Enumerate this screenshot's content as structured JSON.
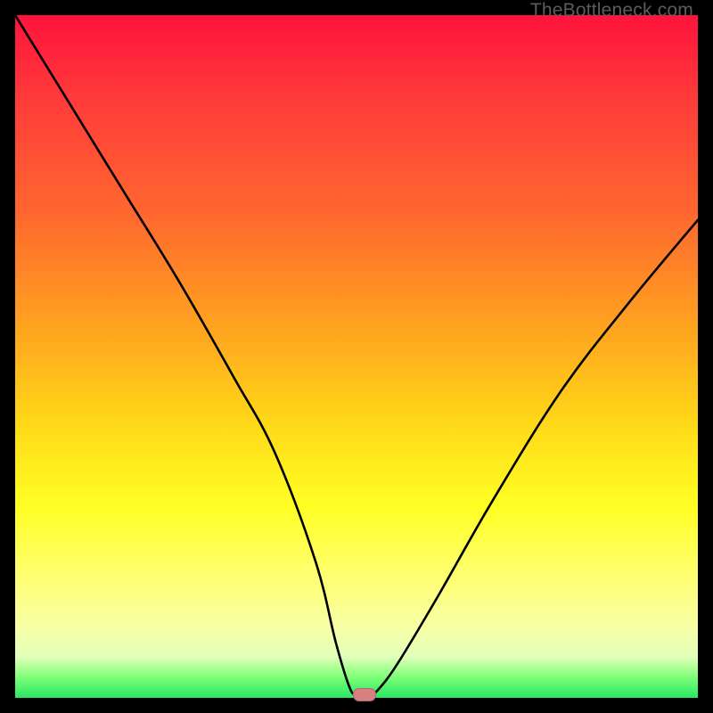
{
  "watermark": "TheBottleneck.com",
  "colors": {
    "frame": "#000000",
    "curve": "#000000",
    "marker": "#d88080",
    "gradient_top": "#ff133c",
    "gradient_bottom": "#29e765"
  },
  "chart_data": {
    "type": "line",
    "title": "",
    "xlabel": "",
    "ylabel": "",
    "xlim": [
      0,
      100
    ],
    "ylim": [
      0,
      100
    ],
    "grid": false,
    "legend": false,
    "series": [
      {
        "name": "bottleneck-curve",
        "x": [
          0,
          8,
          16,
          24,
          32,
          38,
          44,
          47,
          49,
          50,
          51,
          52,
          53,
          56,
          62,
          70,
          80,
          90,
          100
        ],
        "values": [
          100,
          87,
          74,
          61,
          47,
          36,
          20,
          8,
          1.5,
          0.5,
          0.5,
          0.5,
          1,
          5,
          15,
          29,
          45,
          58,
          70
        ]
      }
    ],
    "annotations": [
      {
        "name": "optimal-marker",
        "x": 51,
        "y": 0.5
      }
    ]
  }
}
